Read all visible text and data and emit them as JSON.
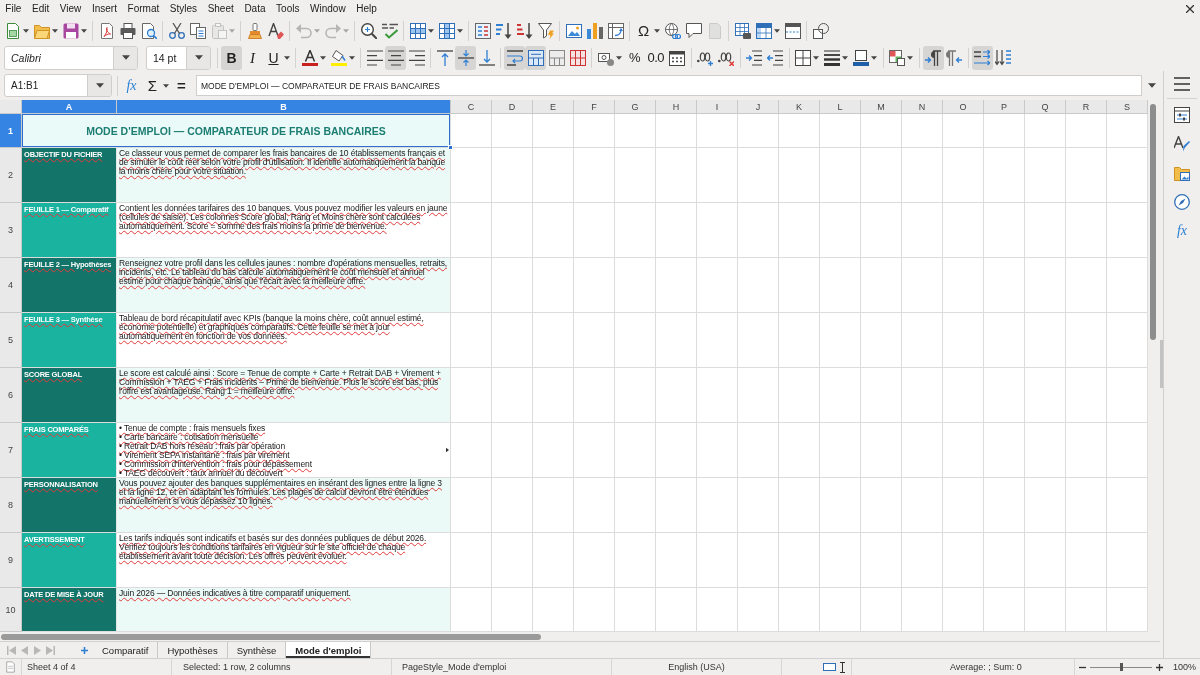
{
  "menu": [
    "File",
    "Edit",
    "View",
    "Insert",
    "Format",
    "Styles",
    "Sheet",
    "Data",
    "Tools",
    "Window",
    "Help"
  ],
  "standard_toolbar": [
    {
      "disabled": false,
      "dropdown": true
    },
    {
      "disabled": false,
      "dropdown": true
    },
    {
      "disabled": false,
      "dropdown": true
    },
    {
      "disabled": false,
      "dropdown": false
    },
    {
      "disabled": false,
      "dropdown": false
    },
    {
      "disabled": false,
      "dropdown": false
    },
    {
      "disabled": false,
      "dropdown": false
    },
    {
      "disabled": false,
      "dropdown": false
    },
    {
      "disabled": true,
      "dropdown": true
    },
    {
      "disabled": false,
      "dropdown": false
    },
    {
      "disabled": false,
      "dropdown": false
    },
    {
      "disabled": true,
      "dropdown": true
    },
    {
      "disabled": true,
      "dropdown": true
    },
    {
      "disabled": false,
      "dropdown": false
    },
    {
      "disabled": false,
      "dropdown": false
    },
    {
      "disabled": false,
      "dropdown": true
    },
    {
      "disabled": false,
      "dropdown": true
    },
    {
      "disabled": false,
      "dropdown": false
    },
    {
      "disabled": false,
      "dropdown": false
    },
    {
      "disabled": false,
      "dropdown": false
    },
    {
      "disabled": false,
      "dropdown": false
    },
    {
      "disabled": false,
      "dropdown": false
    },
    {
      "disabled": false,
      "dropdown": false
    },
    {
      "disabled": false,
      "dropdown": false
    },
    {
      "label": "Ω",
      "disabled": false,
      "dropdown": true
    },
    {
      "disabled": false,
      "dropdown": false
    },
    {
      "disabled": false,
      "dropdown": false
    },
    {
      "disabled": true,
      "dropdown": false
    },
    {
      "disabled": false,
      "dropdown": false
    },
    {
      "disabled": false,
      "dropdown": true
    },
    {
      "disabled": false,
      "dropdown": false
    },
    {
      "disabled": false,
      "dropdown": false
    }
  ],
  "formatting_toolbar": {
    "font_name": "Calibri",
    "font_size": "14 pt",
    "buttons": [
      {
        "label": "B",
        "pressed": true,
        "dropdown": false
      },
      {
        "label": "I",
        "pressed": false,
        "dropdown": false
      },
      {
        "label": "U",
        "pressed": false,
        "dropdown": true
      },
      {
        "pressed": false,
        "dropdown": true
      },
      {
        "pressed": false,
        "dropdown": true
      },
      {
        "pressed": false,
        "dropdown": false
      },
      {
        "pressed": true,
        "dropdown": false
      },
      {
        "pressed": false,
        "dropdown": false
      },
      {
        "pressed": false,
        "dropdown": false
      },
      {
        "pressed": true,
        "dropdown": false
      },
      {
        "pressed": false,
        "dropdown": false
      },
      {
        "pressed": true,
        "dropdown": false
      },
      {
        "pressed": true,
        "dropdown": false
      },
      {
        "pressed": false,
        "dropdown": false
      },
      {
        "pressed": false,
        "dropdown": false
      },
      {
        "pressed": false,
        "dropdown": true
      },
      {
        "label": "%",
        "pressed": false,
        "dropdown": false
      },
      {
        "label": "0.0",
        "pressed": false,
        "dropdown": false
      },
      {
        "pressed": false,
        "dropdown": false
      },
      {
        "pressed": false,
        "dropdown": false
      },
      {
        "pressed": false,
        "dropdown": false
      },
      {
        "pressed": false,
        "dropdown": false
      },
      {
        "pressed": false,
        "dropdown": false
      },
      {
        "pressed": false,
        "dropdown": true
      },
      {
        "pressed": false,
        "dropdown": true
      },
      {
        "pressed": false,
        "dropdown": true
      },
      {
        "pressed": false,
        "dropdown": true
      },
      {
        "pressed": true,
        "dropdown": false
      },
      {
        "pressed": false,
        "dropdown": false
      },
      {
        "pressed": true,
        "dropdown": false
      },
      {
        "pressed": false,
        "dropdown": false
      }
    ]
  },
  "formula_bar": {
    "name_box": "A1:B1",
    "buttons": [
      {
        "label": "fx",
        "dropdown": false
      },
      {
        "label": "Σ",
        "dropdown": true
      },
      {
        "label": "=",
        "dropdown": false
      }
    ],
    "formula": "MODE D'EMPLOI — COMPARATEUR DE FRAIS BANCAIRES"
  },
  "sheet": {
    "columns": [
      {
        "name": "A",
        "selected": true
      },
      {
        "name": "B",
        "selected": true
      },
      {
        "name": "C",
        "selected": false
      },
      {
        "name": "D",
        "selected": false
      },
      {
        "name": "E",
        "selected": false
      },
      {
        "name": "F",
        "selected": false
      },
      {
        "name": "G",
        "selected": false
      },
      {
        "name": "H",
        "selected": false
      },
      {
        "name": "I",
        "selected": false
      },
      {
        "name": "J",
        "selected": false
      },
      {
        "name": "K",
        "selected": false
      },
      {
        "name": "L",
        "selected": false
      },
      {
        "name": "M",
        "selected": false
      },
      {
        "name": "N",
        "selected": false
      },
      {
        "name": "O",
        "selected": false
      },
      {
        "name": "P",
        "selected": false
      },
      {
        "name": "Q",
        "selected": false
      },
      {
        "name": "R",
        "selected": false
      },
      {
        "name": "S",
        "selected": false
      }
    ],
    "title_row": {
      "number": "1",
      "selected": true,
      "text": "MODE D'EMPLOI — COMPARATEUR DE FRAIS BANCAIRES",
      "color": "#eafaf8"
    },
    "rows": [
      {
        "number": "2",
        "selected": false,
        "label": {
          "text": "OBJECTIF DU FICHIER",
          "color": "#137569"
        },
        "description": {
          "text": "Ce classeur vous permet de comparer les frais bancaires de 10 établissements français et de simuler le coût réel selon votre profil d'utilisation. Il identifie automatiquement la banque la moins chère pour votre situation.",
          "color": "#ebfaf7"
        },
        "overflow": false
      },
      {
        "number": "3",
        "selected": false,
        "label": {
          "text": "FEUILLE 1 — Comparatif",
          "color": "#19b3a0"
        },
        "description": {
          "text": "Contient les données tarifaires des 10 banques. Vous pouvez modifier les valeurs en jaune (cellules de saisie). Les colonnes Score global, Rang et Moins chère sont calculées automatiquement. Score = somme des frais moins la prime de bienvenue.",
          "color": "#ffffff"
        },
        "overflow": false
      },
      {
        "number": "4",
        "selected": false,
        "label": {
          "text": "FEUILLE 2 — Hypothèses",
          "color": "#137569"
        },
        "description": {
          "text": "Renseignez votre profil dans les cellules jaunes : nombre d'opérations mensuelles, retraits, incidents, etc. Le tableau du bas calcule automatiquement le coût mensuel et annuel estimé pour chaque banque, ainsi que l'écart avec la meilleure offre.",
          "color": "#ebfaf7"
        },
        "overflow": false
      },
      {
        "number": "5",
        "selected": false,
        "label": {
          "text": "FEUILLE 3 — Synthèse",
          "color": "#19b3a0"
        },
        "description": {
          "text": "Tableau de bord récapitulatif avec KPIs (banque la moins chère, coût annuel estimé, économie potentielle) et graphiques comparatifs. Cette feuille se met à jour automatiquement en fonction de vos données.",
          "color": "#ffffff"
        },
        "overflow": false
      },
      {
        "number": "6",
        "selected": false,
        "label": {
          "text": "SCORE GLOBAL",
          "color": "#137569"
        },
        "description": {
          "text": "Le score est calculé ainsi : Score = Tenue de compte + Carte + Retrait DAB + Virement + Commission + TAEG + Frais incidents – Prime de bienvenue. Plus le score est bas, plus l'offre est avantageuse. Rang 1 = meilleure offre.",
          "color": "#ebfaf7"
        },
        "overflow": false
      },
      {
        "number": "7",
        "selected": false,
        "label": {
          "text": "FRAIS COMPARÉS",
          "color": "#19b3a0"
        },
        "description": {
          "text": "• Tenue de compte : frais mensuels fixes\n• Carte bancaire : cotisation mensuelle\n• Retrait DAB hors réseau : frais par opération\n• Virement SEPA instantané : frais par virement\n• Commission d'intervention : frais pour dépassement\n• TAEG découvert : taux annuel du découvert",
          "color": "#ffffff"
        },
        "overflow": true
      },
      {
        "number": "8",
        "selected": false,
        "label": {
          "text": "PERSONNALISATION",
          "color": "#137569"
        },
        "description": {
          "text": "Vous pouvez ajouter des banques supplémentaires en insérant des lignes entre la ligne 3 et la ligne 12, et en adaptant les formules. Les plages de calcul devront être étendues manuellement si vous dépassez 10 lignes.",
          "color": "#ebfaf7"
        },
        "overflow": false
      },
      {
        "number": "9",
        "selected": false,
        "label": {
          "text": "AVERTISSEMENT",
          "color": "#19b3a0"
        },
        "description": {
          "text": "Les tarifs indiqués sont indicatifs et basés sur des données publiques de début 2026. Vérifiez toujours les conditions tarifaires en vigueur sur le site officiel de chaque établissement avant toute décision. Les offres peuvent évoluer.",
          "color": "#ffffff"
        },
        "overflow": false
      },
      {
        "number": "10",
        "selected": false,
        "label": {
          "text": "DATE DE MISE À JOUR",
          "color": "#137569"
        },
        "description": {
          "text": "Juin 2026 — Données indicatives à titre comparatif uniquement.",
          "color": "#ebfaf7"
        },
        "overflow": false
      }
    ]
  },
  "sheet_tabs": {
    "navigation_disabled": true,
    "tabs": [
      {
        "label": "Comparatif",
        "selected": false
      },
      {
        "label": "Hypothèses",
        "selected": false
      },
      {
        "label": "Synthèse",
        "selected": false
      },
      {
        "label": "Mode d'emploi",
        "selected": true
      }
    ]
  },
  "sidebar": {
    "functions_label": "fx"
  },
  "status_bar": {
    "sheet": "Sheet 4 of 4",
    "selection": "Selected: 1 row, 2 columns",
    "page_style": "PageStyle_Mode d'emploi",
    "language": "English (USA)",
    "summary": "Average: ; Sum: 0",
    "zoom": {
      "level": 0.5,
      "reading": "100%"
    }
  }
}
